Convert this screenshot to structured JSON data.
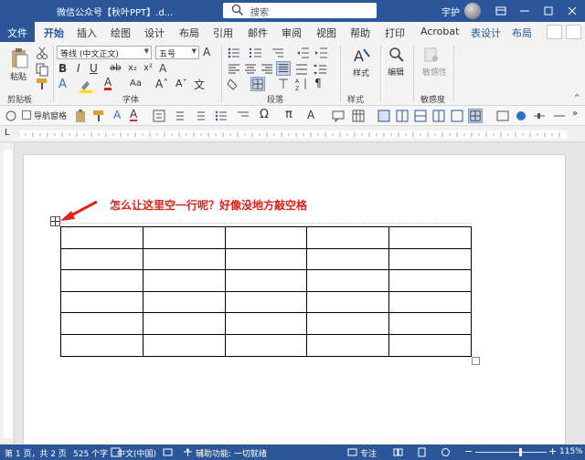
{
  "titlebar": {
    "doc_title": "微信公众号【秋叶PPT】.d...",
    "search_placeholder": "搜索",
    "user": "宇护"
  },
  "tabs": {
    "file": "文件",
    "home": "开始",
    "insert": "插入",
    "draw": "绘图",
    "design": "设计",
    "layout": "布局",
    "references": "引用",
    "mailings": "邮件",
    "review": "审阅",
    "view": "视图",
    "help": "帮助",
    "print": "打印",
    "acrobat": "Acrobat",
    "table_design": "表设计",
    "table_layout": "布局"
  },
  "ribbon": {
    "paste": "粘贴",
    "font_name": "等线 (中文正文)",
    "font_size": "五号",
    "styles": "样式",
    "editing": "编辑",
    "sensitivity": "敏感性",
    "groups": {
      "clipboard": "剪贴板",
      "font": "字体",
      "paragraph": "段落",
      "styles": "样式",
      "sensitivity": "敏感度"
    }
  },
  "qat": {
    "nav_pane": "导航窗格"
  },
  "document": {
    "annotation": "怎么让这里空一行呢？好像没地方敲空格",
    "table_rows": 6,
    "table_cols": 5
  },
  "statusbar": {
    "page": "第 1 页，共 2 页",
    "words": "525 个字",
    "language": "中文(中国)",
    "accessibility": "辅助功能: 一切就绪",
    "focus": "专注",
    "zoom": "115%"
  },
  "colors": {
    "accent": "#2b579a",
    "annotation_red": "#e0221b"
  }
}
